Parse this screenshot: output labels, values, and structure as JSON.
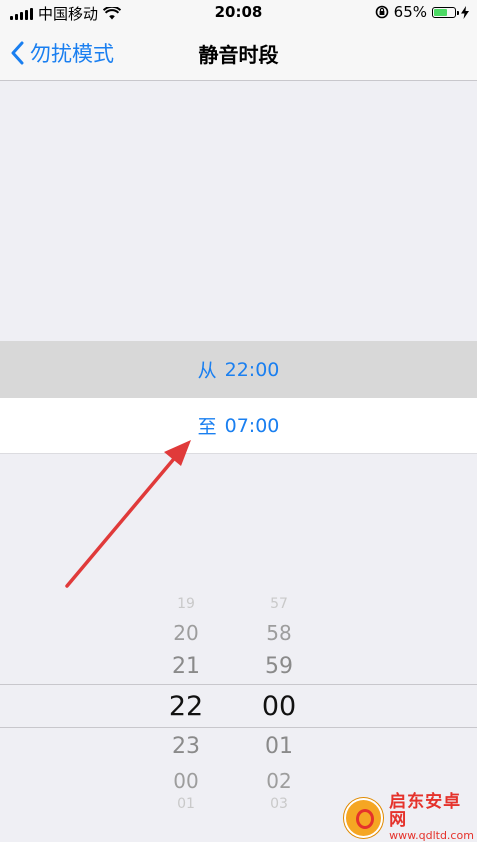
{
  "status": {
    "carrier": "中国移动",
    "time": "20:08",
    "battery_percent": "65%",
    "battery_level": 0.65
  },
  "nav": {
    "back_label": "勿扰模式",
    "title": "静音时段"
  },
  "schedule": {
    "from_label": "从",
    "from_time": "22:00",
    "to_label": "至",
    "to_time": "07:00"
  },
  "picker": {
    "hours": [
      "19",
      "20",
      "21",
      "22",
      "23",
      "00",
      "01"
    ],
    "minutes": [
      "57",
      "58",
      "59",
      "00",
      "01",
      "02",
      "03"
    ],
    "selected_hour": "22",
    "selected_minute": "00"
  },
  "watermark": {
    "name": "启东安卓网",
    "url": "www.qdltd.com"
  },
  "colors": {
    "accent": "#1a7ff0",
    "arrow": "#e03a3a",
    "battery": "#4cd964"
  }
}
